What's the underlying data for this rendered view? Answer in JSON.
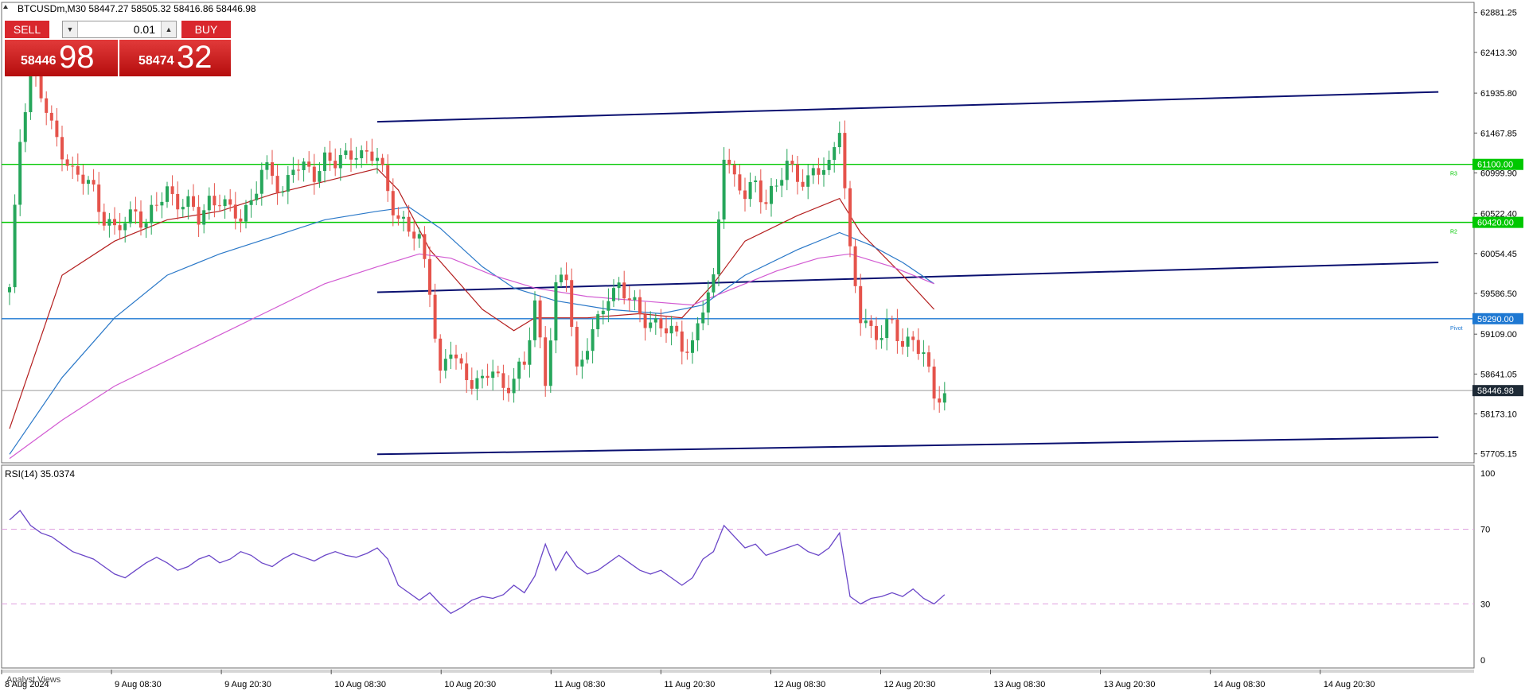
{
  "header": {
    "symbol_line": "BTCUSDm,M30  58447.27 58505.32 58416.86 58446.98"
  },
  "trade_panel": {
    "sell_label": "SELL",
    "buy_label": "BUY",
    "lot_value": "0.01",
    "sell_price_small": "58446",
    "sell_price_big": "98",
    "buy_price_small": "58474",
    "buy_price_big": "32"
  },
  "chart_data": {
    "type": "candlestick",
    "symbol": "BTCUSDm",
    "timeframe": "M30",
    "price_axis_ticks": [
      "62881.25",
      "62413.30",
      "61935.80",
      "61467.85",
      "60999.90",
      "60522.40",
      "60054.45",
      "59586.50",
      "59109.00",
      "58641.05",
      "58173.10",
      "57705.15"
    ],
    "price_axis_ticks_values": [
      62881.25,
      62413.3,
      61935.8,
      61467.85,
      60999.9,
      60522.4,
      60054.45,
      59586.5,
      59109.0,
      58641.05,
      58173.1,
      57705.15
    ],
    "price_range": [
      57600,
      63000
    ],
    "time_axis_labels": [
      "8 Aug 2024",
      "9 Aug 08:30",
      "9 Aug 20:30",
      "10 Aug 08:30",
      "10 Aug 20:30",
      "11 Aug 08:30",
      "11 Aug 20:30",
      "12 Aug 08:30",
      "12 Aug 20:30",
      "13 Aug 08:30",
      "13 Aug 20:30",
      "14 Aug 08:30",
      "14 Aug 20:30"
    ],
    "horizontal_levels": [
      {
        "label": "61100.00",
        "tag": "R3",
        "value": 61100.0,
        "color": "#00c800"
      },
      {
        "label": "60420.00",
        "tag": "R2",
        "value": 60420.0,
        "color": "#00c800"
      },
      {
        "label": "59290.00",
        "tag": "Pivot",
        "value": 59290.0,
        "color": "#1e78d2"
      }
    ],
    "current_price": {
      "label": "58446.98",
      "value": 58446.98
    },
    "close_path": [
      [
        0,
        59600
      ],
      [
        2,
        61400
      ],
      [
        4,
        62300
      ],
      [
        6,
        61900
      ],
      [
        8,
        61500
      ],
      [
        10,
        61300
      ],
      [
        12,
        61000
      ],
      [
        14,
        60900
      ],
      [
        16,
        60800
      ],
      [
        18,
        60500
      ],
      [
        20,
        60300
      ],
      [
        22,
        60400
      ],
      [
        24,
        60600
      ],
      [
        26,
        60400
      ],
      [
        28,
        60600
      ],
      [
        30,
        60800
      ],
      [
        32,
        60700
      ],
      [
        34,
        60600
      ],
      [
        36,
        60450
      ],
      [
        38,
        60700
      ],
      [
        40,
        60700
      ],
      [
        42,
        60500
      ],
      [
        44,
        60500
      ],
      [
        46,
        60700
      ],
      [
        48,
        61000
      ],
      [
        50,
        60950
      ],
      [
        52,
        60800
      ],
      [
        54,
        61100
      ],
      [
        56,
        61000
      ],
      [
        58,
        61000
      ],
      [
        60,
        61200
      ],
      [
        62,
        61100
      ],
      [
        64,
        61150
      ],
      [
        66,
        61300
      ],
      [
        68,
        61200
      ],
      [
        70,
        61150
      ],
      [
        72,
        60800
      ],
      [
        74,
        60500
      ],
      [
        76,
        60300
      ],
      [
        78,
        60200
      ],
      [
        80,
        59700
      ],
      [
        82,
        58600
      ],
      [
        84,
        58900
      ],
      [
        86,
        58700
      ],
      [
        88,
        58600
      ],
      [
        90,
        58500
      ],
      [
        92,
        58700
      ],
      [
        94,
        58500
      ],
      [
        96,
        58600
      ],
      [
        98,
        58700
      ],
      [
        100,
        59500
      ],
      [
        102,
        58600
      ],
      [
        104,
        59600
      ],
      [
        106,
        59800
      ],
      [
        108,
        58700
      ],
      [
        110,
        59000
      ],
      [
        112,
        59200
      ],
      [
        114,
        59600
      ],
      [
        116,
        59700
      ],
      [
        118,
        59500
      ],
      [
        120,
        59300
      ],
      [
        122,
        59300
      ],
      [
        124,
        59200
      ],
      [
        126,
        59100
      ],
      [
        128,
        59000
      ],
      [
        130,
        59000
      ],
      [
        132,
        59400
      ],
      [
        134,
        59700
      ],
      [
        136,
        61300
      ],
      [
        138,
        60900
      ],
      [
        140,
        60700
      ],
      [
        142,
        60900
      ],
      [
        144,
        60700
      ],
      [
        146,
        60800
      ],
      [
        148,
        61100
      ],
      [
        150,
        61000
      ],
      [
        152,
        60900
      ],
      [
        154,
        61000
      ],
      [
        156,
        61100
      ],
      [
        158,
        61600
      ],
      [
        160,
        60000
      ],
      [
        162,
        59300
      ],
      [
        164,
        59200
      ],
      [
        166,
        59100
      ],
      [
        168,
        59200
      ],
      [
        170,
        59000
      ],
      [
        172,
        59100
      ],
      [
        174,
        58800
      ],
      [
        176,
        58400
      ],
      [
        178,
        58400
      ]
    ],
    "moving_averages": [
      {
        "color": "#b41e1e",
        "points": [
          [
            0,
            58000
          ],
          [
            10,
            59800
          ],
          [
            20,
            60200
          ],
          [
            30,
            60450
          ],
          [
            40,
            60550
          ],
          [
            50,
            60750
          ],
          [
            60,
            60900
          ],
          [
            70,
            61050
          ],
          [
            74,
            60800
          ],
          [
            80,
            60100
          ],
          [
            90,
            59400
          ],
          [
            96,
            59150
          ],
          [
            100,
            59300
          ],
          [
            110,
            59300
          ],
          [
            120,
            59350
          ],
          [
            128,
            59300
          ],
          [
            134,
            59700
          ],
          [
            140,
            60200
          ],
          [
            150,
            60500
          ],
          [
            158,
            60700
          ],
          [
            162,
            60300
          ],
          [
            170,
            59800
          ],
          [
            176,
            59400
          ]
        ]
      },
      {
        "color": "#2a78c8",
        "points": [
          [
            0,
            57700
          ],
          [
            10,
            58600
          ],
          [
            20,
            59300
          ],
          [
            30,
            59800
          ],
          [
            40,
            60050
          ],
          [
            50,
            60250
          ],
          [
            60,
            60450
          ],
          [
            70,
            60550
          ],
          [
            76,
            60600
          ],
          [
            82,
            60350
          ],
          [
            90,
            59900
          ],
          [
            96,
            59650
          ],
          [
            104,
            59500
          ],
          [
            114,
            59400
          ],
          [
            124,
            59350
          ],
          [
            132,
            59450
          ],
          [
            140,
            59800
          ],
          [
            150,
            60100
          ],
          [
            158,
            60300
          ],
          [
            164,
            60150
          ],
          [
            170,
            59950
          ],
          [
            176,
            59700
          ]
        ]
      },
      {
        "color": "#d25ad2",
        "points": [
          [
            0,
            57650
          ],
          [
            10,
            58100
          ],
          [
            20,
            58500
          ],
          [
            30,
            58800
          ],
          [
            40,
            59100
          ],
          [
            50,
            59400
          ],
          [
            60,
            59700
          ],
          [
            70,
            59900
          ],
          [
            78,
            60050
          ],
          [
            84,
            60000
          ],
          [
            92,
            59800
          ],
          [
            100,
            59650
          ],
          [
            110,
            59550
          ],
          [
            120,
            59500
          ],
          [
            130,
            59450
          ],
          [
            138,
            59650
          ],
          [
            146,
            59850
          ],
          [
            154,
            60000
          ],
          [
            160,
            60050
          ],
          [
            168,
            59900
          ],
          [
            176,
            59700
          ]
        ]
      }
    ],
    "channel_lines": [
      {
        "from": [
          70,
          61600
        ],
        "to": [
          272,
          61950
        ]
      },
      {
        "from": [
          70,
          59600
        ],
        "to": [
          272,
          59950
        ]
      },
      {
        "from": [
          70,
          57700
        ],
        "to": [
          272,
          57900
        ]
      }
    ],
    "rsi": {
      "label": "RSI(14) 35.0374",
      "ticks": [
        "100",
        "70",
        "30",
        "0"
      ],
      "tick_values": [
        100,
        70,
        30,
        0
      ],
      "levels": [
        70,
        30
      ],
      "values": [
        [
          0,
          75
        ],
        [
          2,
          80
        ],
        [
          4,
          72
        ],
        [
          6,
          68
        ],
        [
          8,
          66
        ],
        [
          10,
          62
        ],
        [
          12,
          58
        ],
        [
          14,
          56
        ],
        [
          16,
          54
        ],
        [
          18,
          50
        ],
        [
          20,
          46
        ],
        [
          22,
          44
        ],
        [
          24,
          48
        ],
        [
          26,
          52
        ],
        [
          28,
          55
        ],
        [
          30,
          52
        ],
        [
          32,
          48
        ],
        [
          34,
          50
        ],
        [
          36,
          54
        ],
        [
          38,
          56
        ],
        [
          40,
          52
        ],
        [
          42,
          54
        ],
        [
          44,
          58
        ],
        [
          46,
          56
        ],
        [
          48,
          52
        ],
        [
          50,
          50
        ],
        [
          52,
          54
        ],
        [
          54,
          57
        ],
        [
          56,
          55
        ],
        [
          58,
          53
        ],
        [
          60,
          56
        ],
        [
          62,
          58
        ],
        [
          64,
          56
        ],
        [
          66,
          55
        ],
        [
          68,
          57
        ],
        [
          70,
          60
        ],
        [
          72,
          54
        ],
        [
          74,
          40
        ],
        [
          76,
          36
        ],
        [
          78,
          32
        ],
        [
          80,
          36
        ],
        [
          82,
          30
        ],
        [
          84,
          25
        ],
        [
          86,
          28
        ],
        [
          88,
          32
        ],
        [
          90,
          34
        ],
        [
          92,
          33
        ],
        [
          94,
          35
        ],
        [
          96,
          40
        ],
        [
          98,
          36
        ],
        [
          100,
          45
        ],
        [
          102,
          62
        ],
        [
          104,
          48
        ],
        [
          106,
          58
        ],
        [
          108,
          50
        ],
        [
          110,
          46
        ],
        [
          112,
          48
        ],
        [
          114,
          52
        ],
        [
          116,
          56
        ],
        [
          118,
          52
        ],
        [
          120,
          48
        ],
        [
          122,
          46
        ],
        [
          124,
          48
        ],
        [
          126,
          44
        ],
        [
          128,
          40
        ],
        [
          130,
          44
        ],
        [
          132,
          54
        ],
        [
          134,
          58
        ],
        [
          136,
          72
        ],
        [
          138,
          66
        ],
        [
          140,
          60
        ],
        [
          142,
          62
        ],
        [
          144,
          56
        ],
        [
          146,
          58
        ],
        [
          148,
          60
        ],
        [
          150,
          62
        ],
        [
          152,
          58
        ],
        [
          154,
          56
        ],
        [
          156,
          60
        ],
        [
          158,
          68
        ],
        [
          160,
          34
        ],
        [
          162,
          30
        ],
        [
          164,
          33
        ],
        [
          166,
          34
        ],
        [
          168,
          36
        ],
        [
          170,
          34
        ],
        [
          172,
          38
        ],
        [
          174,
          33
        ],
        [
          176,
          30
        ],
        [
          178,
          35
        ]
      ]
    }
  },
  "bottom_tab": {
    "label": "Analyst Views"
  }
}
